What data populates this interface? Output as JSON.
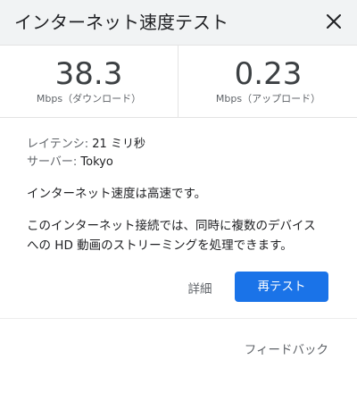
{
  "header": {
    "title": "インターネット速度テスト",
    "close_icon": "close-icon"
  },
  "results": {
    "download": {
      "value": "38.3",
      "unit": "Mbps（ダウンロード）"
    },
    "upload": {
      "value": "0.23",
      "unit": "Mbps（アップロード）"
    }
  },
  "details": {
    "latency_label": "レイテンシ:",
    "latency_value": "21 ミリ秒",
    "server_label": "サーバー:",
    "server_value": "Tokyo"
  },
  "summary": "インターネット速度は高速です。",
  "description": {
    "line1": "このインターネット接続では、同時に複数のデバイス",
    "line2": "への HD 動画のストリーミングを処理できます。"
  },
  "actions": {
    "details_label": "詳細",
    "retest_label": "再テスト"
  },
  "footer": {
    "feedback_label": "フィードバック"
  },
  "colors": {
    "accent": "#1a73e8",
    "header_bg": "#f1f3f4"
  }
}
